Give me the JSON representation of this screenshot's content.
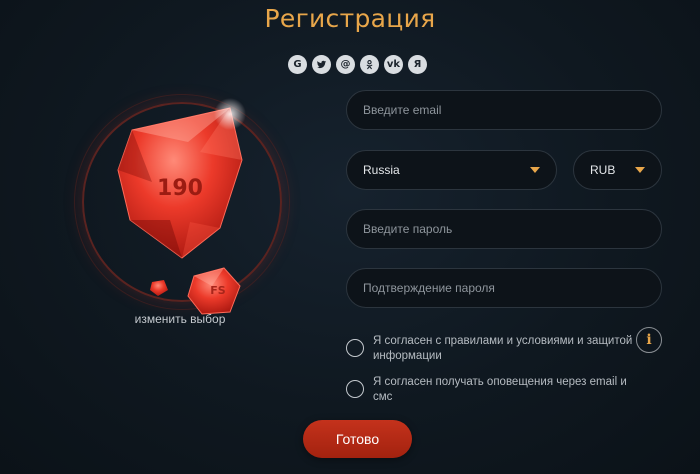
{
  "header": {
    "title": "Регистрация"
  },
  "socials": [
    {
      "icon": "google-icon",
      "glyph": "G"
    },
    {
      "icon": "twitter-icon",
      "glyph": ""
    },
    {
      "icon": "mail-icon",
      "glyph": "@"
    },
    {
      "icon": "odnoklassniki-icon",
      "glyph": ""
    },
    {
      "icon": "vk-icon",
      "glyph": "vk"
    },
    {
      "icon": "yandex-icon",
      "glyph": "Я"
    }
  ],
  "bonus": {
    "gem_value": "190",
    "small_gem_label": "FS",
    "change_link": "изменить выбор"
  },
  "form": {
    "email_placeholder": "Введите email",
    "country_value": "Russia",
    "currency_value": "RUB",
    "password_placeholder": "Введите пароль",
    "password_confirm_placeholder": "Подтверждение пароля",
    "agree_terms": "Я согласен с правилами и условиями и защитой информации",
    "agree_notifications": "Я согласен получать оповещения через email и смс",
    "info_glyph": "i",
    "submit_label": "Готово"
  },
  "colors": {
    "accent": "#e8a64a",
    "button": "#b42814",
    "gem": "#e8382a",
    "background": "#111a22"
  }
}
